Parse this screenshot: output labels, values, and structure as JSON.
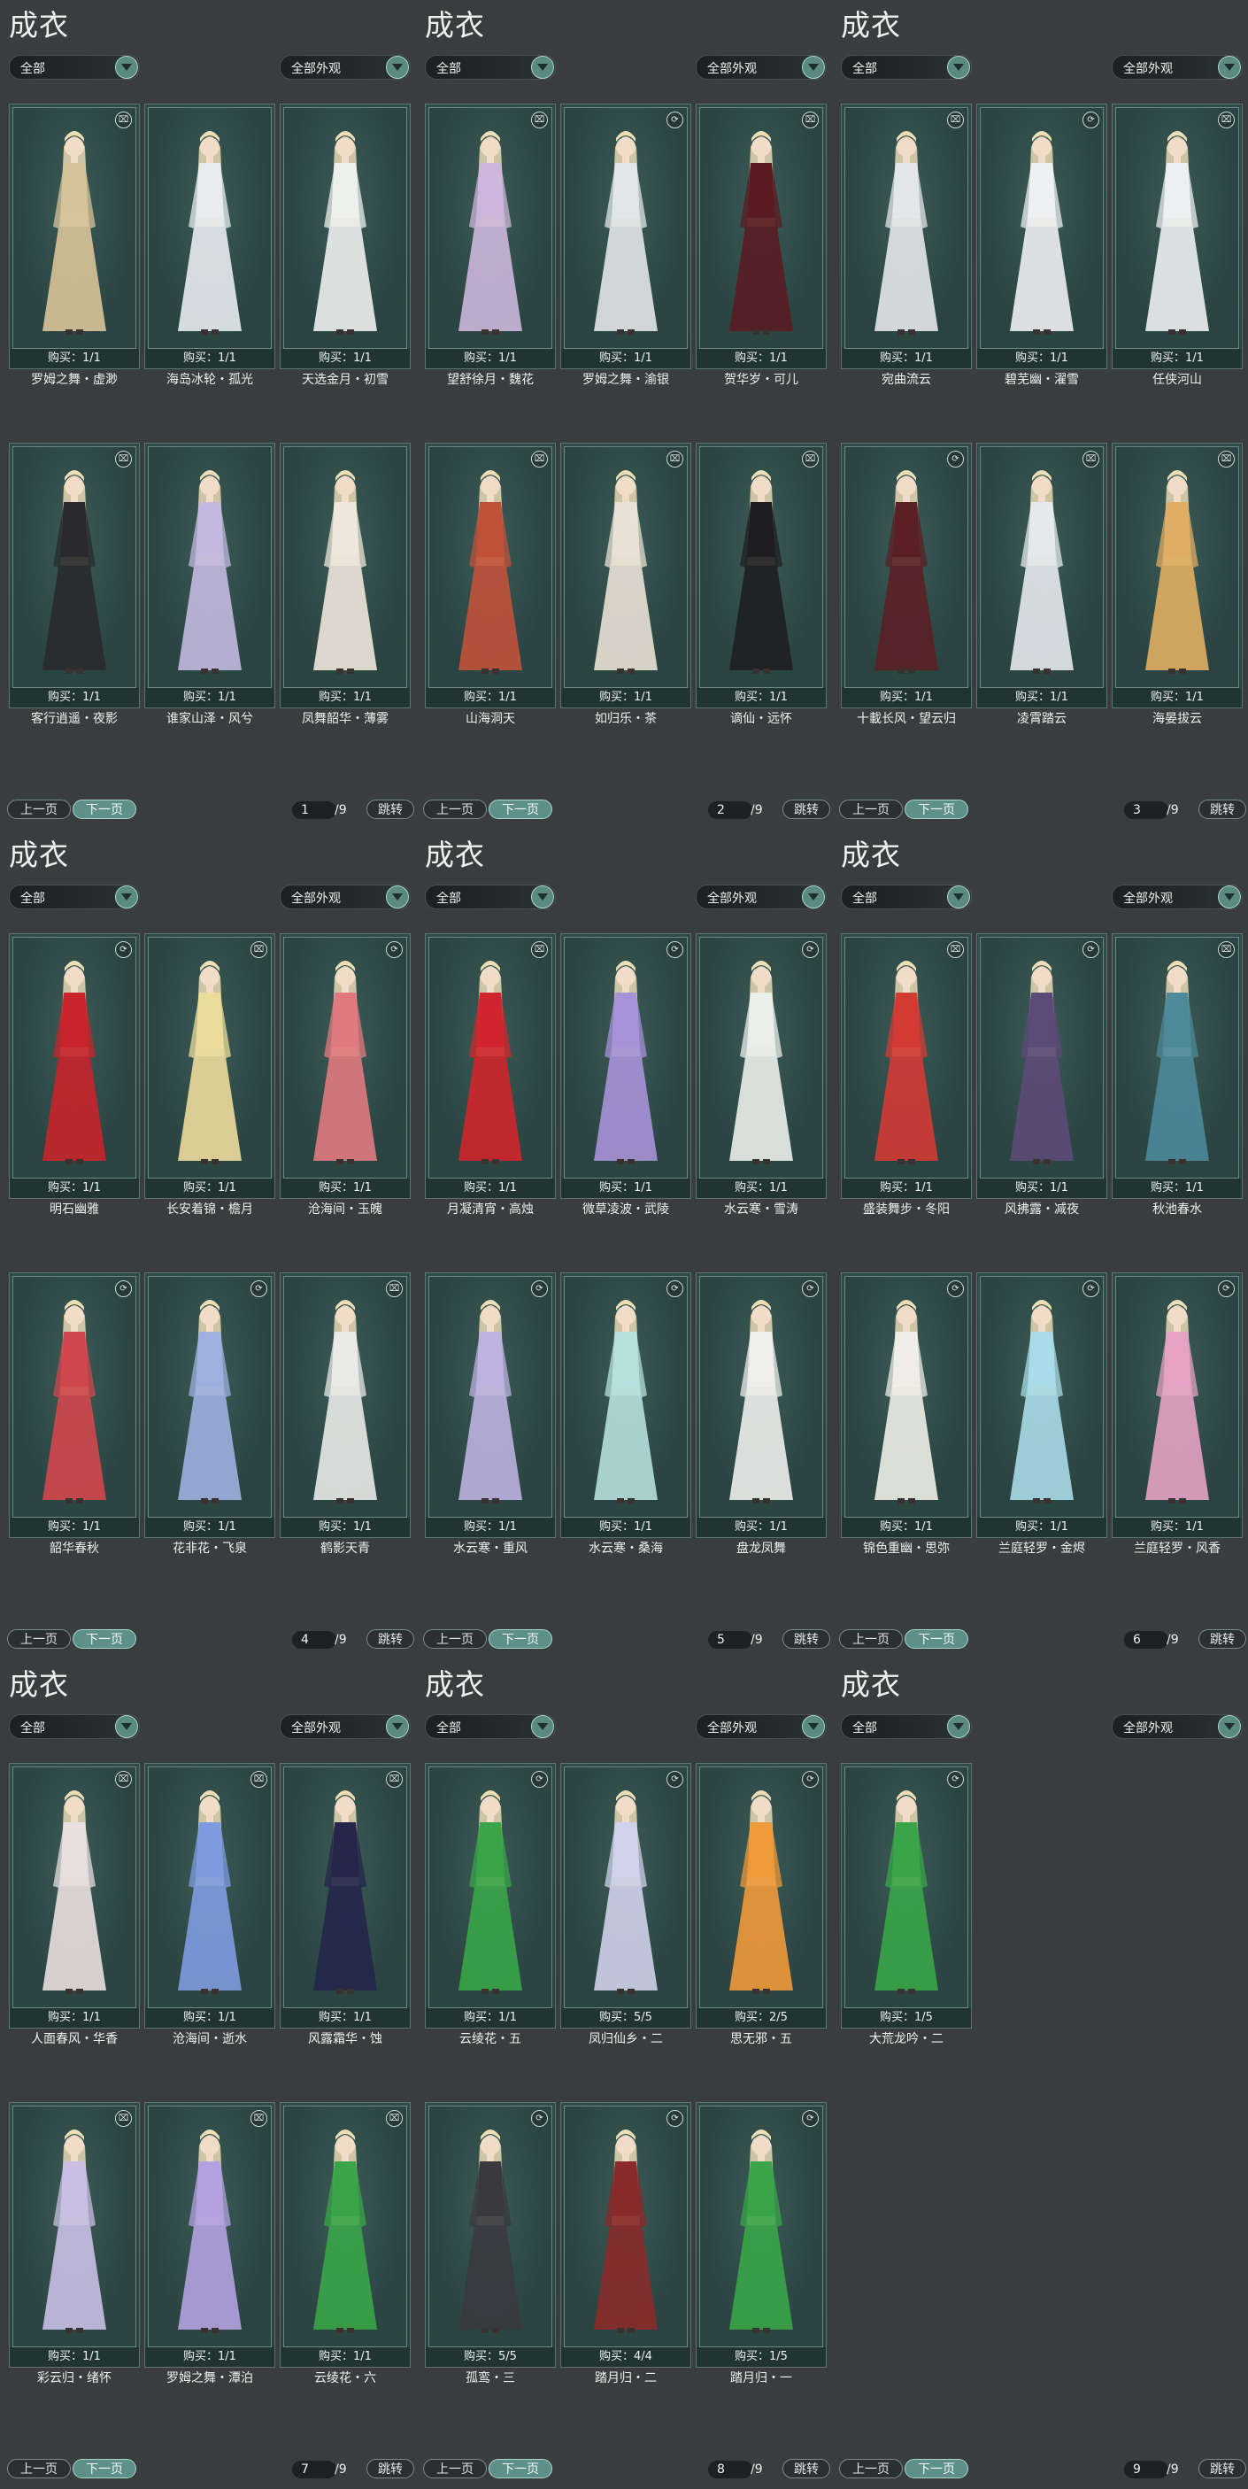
{
  "panels": [
    {
      "title": "成衣",
      "filter": "全部",
      "filter2": "全部外观",
      "page": "1",
      "total": "/9",
      "prev": "上一页",
      "next": "下一页",
      "jump": "跳转",
      "items": [
        {
          "name": "罗姆之舞・虚渺",
          "buy": "购买：1/1",
          "icon": "trash-icon",
          "robe": "#d8c49a"
        },
        {
          "name": "海岛冰轮・孤光",
          "buy": "购买：1/1",
          "icon": "",
          "robe": "#e8ecef"
        },
        {
          "name": "天选金月・初雪",
          "buy": "购买：1/1",
          "icon": "",
          "robe": "#eef0ee"
        },
        {
          "name": "客行逍遥・夜影",
          "buy": "购买：1/1",
          "icon": "trash-icon",
          "robe": "#2a2a2e"
        },
        {
          "name": "谁家山泽・风兮",
          "buy": "购买：1/1",
          "icon": "",
          "robe": "#c3b9e0"
        },
        {
          "name": "凤舞韶华・薄雾",
          "buy": "购买：1/1",
          "icon": "",
          "robe": "#efe7db"
        }
      ]
    },
    {
      "title": "成衣",
      "filter": "全部",
      "filter2": "全部外观",
      "page": "2",
      "total": "/9",
      "prev": "上一页",
      "next": "下一页",
      "jump": "跳转",
      "items": [
        {
          "name": "望舒徐月・魏花",
          "buy": "购买：1/1",
          "icon": "trash-icon",
          "robe": "#cdb6dc"
        },
        {
          "name": "罗姆之舞・渝银",
          "buy": "购买：1/1",
          "icon": "refresh-icon",
          "robe": "#e2e5e8"
        },
        {
          "name": "贺华岁・可儿",
          "buy": "购买：1/1",
          "icon": "trash-icon",
          "robe": "#5a1c22"
        },
        {
          "name": "山海洞天",
          "buy": "购买：1/1",
          "icon": "trash-icon",
          "robe": "#c0523a"
        },
        {
          "name": "如归乐・茶",
          "buy": "购买：1/1",
          "icon": "trash-icon",
          "robe": "#e9e1d5"
        },
        {
          "name": "谪仙・远怀",
          "buy": "购买：1/1",
          "icon": "trash-icon",
          "robe": "#1f1f22"
        }
      ]
    },
    {
      "title": "成衣",
      "filter": "全部",
      "filter2": "全部外观",
      "page": "3",
      "total": "/9",
      "prev": "上一页",
      "next": "下一页",
      "jump": "跳转",
      "items": [
        {
          "name": "宛曲流云",
          "buy": "购买：1/1",
          "icon": "trash-icon",
          "robe": "#e4e7ea"
        },
        {
          "name": "碧芜幽・濯雪",
          "buy": "购买：1/1",
          "icon": "refresh-icon",
          "robe": "#eef0f2"
        },
        {
          "name": "任侠河山",
          "buy": "购买：1/1",
          "icon": "trash-icon",
          "robe": "#edeff1"
        },
        {
          "name": "十載长风・望云归",
          "buy": "购买：1/1",
          "icon": "refresh-icon",
          "robe": "#5a2025"
        },
        {
          "name": "凌霄踏云",
          "buy": "购买：1/1",
          "icon": "trash-icon",
          "robe": "#e6e9ec"
        },
        {
          "name": "海晏拔云",
          "buy": "购买：1/1",
          "icon": "trash-icon",
          "robe": "#e0ae62"
        }
      ]
    },
    {
      "title": "成衣",
      "filter": "全部",
      "filter2": "全部外观",
      "page": "4",
      "total": "/9",
      "prev": "上一页",
      "next": "下一页",
      "jump": "跳转",
      "items": [
        {
          "name": "明石幽雅",
          "buy": "购买：1/1",
          "icon": "refresh-icon",
          "robe": "#c8242a"
        },
        {
          "name": "长安着锦・檐月",
          "buy": "购买：1/1",
          "icon": "trash-icon",
          "robe": "#ecdc9c"
        },
        {
          "name": "沧海间・玉魄",
          "buy": "购买：1/1",
          "icon": "refresh-icon",
          "robe": "#e07a80"
        },
        {
          "name": "韶华春秋",
          "buy": "购买：1/1",
          "icon": "refresh-icon",
          "robe": "#d2474d"
        },
        {
          "name": "花非花・飞泉",
          "buy": "购买：1/1",
          "icon": "refresh-icon",
          "robe": "#9fb0e0"
        },
        {
          "name": "鹤影天青",
          "buy": "购买：1/1",
          "icon": "trash-icon",
          "robe": "#e9eae8"
        }
      ]
    },
    {
      "title": "成衣",
      "filter": "全部",
      "filter2": "全部外观",
      "page": "5",
      "total": "/9",
      "prev": "上一页",
      "next": "下一页",
      "jump": "跳转",
      "items": [
        {
          "name": "月凝清宵・高烛",
          "buy": "购买：1/1",
          "icon": "trash-icon",
          "robe": "#d0252c"
        },
        {
          "name": "微草凌波・武陵",
          "buy": "购买：1/1",
          "icon": "refresh-icon",
          "robe": "#a792d8"
        },
        {
          "name": "水云寒・雪涛",
          "buy": "购买：1/1",
          "icon": "refresh-icon",
          "robe": "#ebeeea"
        },
        {
          "name": "水云寒・重风",
          "buy": "购买：1/1",
          "icon": "refresh-icon",
          "robe": "#bdb2e0"
        },
        {
          "name": "水云寒・桑海",
          "buy": "购买：1/1",
          "icon": "refresh-icon",
          "robe": "#b6e0de"
        },
        {
          "name": "盘龙凤舞",
          "buy": "购买：1/1",
          "icon": "refresh-icon",
          "robe": "#eeeeec"
        }
      ]
    },
    {
      "title": "成衣",
      "filter": "全部",
      "filter2": "全部外观",
      "page": "6",
      "total": "/9",
      "prev": "上一页",
      "next": "下一页",
      "jump": "跳转",
      "items": [
        {
          "name": "盛装舞步・冬阳",
          "buy": "购买：1/1",
          "icon": "trash-icon",
          "robe": "#d33a34"
        },
        {
          "name": "风拂露・减夜",
          "buy": "购买：1/1",
          "icon": "refresh-icon",
          "robe": "#5c4a78"
        },
        {
          "name": "秋池春水",
          "buy": "购买：1/1",
          "icon": "trash-icon",
          "robe": "#4d8a9a"
        },
        {
          "name": "锦色重幽・思弥",
          "buy": "购买：1/1",
          "icon": "refresh-icon",
          "robe": "#eeeee6"
        },
        {
          "name": "兰庭轻罗・金烬",
          "buy": "购买：1/1",
          "icon": "refresh-icon",
          "robe": "#a8dce8"
        },
        {
          "name": "兰庭轻罗・风香",
          "buy": "购买：1/1",
          "icon": "refresh-icon",
          "robe": "#e6a2c4"
        }
      ]
    },
    {
      "title": "成衣",
      "filter": "全部",
      "filter2": "全部外观",
      "page": "7",
      "total": "/9",
      "prev": "上一页",
      "next": "下一页",
      "jump": "跳转",
      "items": [
        {
          "name": "人面春风・华香",
          "buy": "购买：1/1",
          "icon": "trash-icon",
          "robe": "#eadfe0"
        },
        {
          "name": "沧海间・逝水",
          "buy": "购买：1/1",
          "icon": "trash-icon",
          "robe": "#7f9be0"
        },
        {
          "name": "风露霜华・蚀",
          "buy": "购买：1/1",
          "icon": "trash-icon",
          "robe": "#25264a"
        },
        {
          "name": "彩云归・绪怀",
          "buy": "购买：1/1",
          "icon": "trash-icon",
          "robe": "#c9bfe4"
        },
        {
          "name": "罗姆之舞・潭泊",
          "buy": "购买：1/1",
          "icon": "trash-icon",
          "robe": "#b4a1e0"
        },
        {
          "name": "云绫花・六",
          "buy": "购买：1/1",
          "icon": "trash-icon",
          "robe": "#3aa548"
        }
      ]
    },
    {
      "title": "成衣",
      "filter": "全部",
      "filter2": "全部外观",
      "page": "8",
      "total": "/9",
      "prev": "上一页",
      "next": "下一页",
      "jump": "跳转",
      "items": [
        {
          "name": "云绫花・五",
          "buy": "购买：1/1",
          "icon": "refresh-icon",
          "robe": "#3aa548"
        },
        {
          "name": "凤归仙乡・二",
          "buy": "购买：5/5",
          "icon": "refresh-icon",
          "robe": "#cfd2ea"
        },
        {
          "name": "思无邪・五",
          "buy": "购买：2/5",
          "icon": "refresh-icon",
          "robe": "#ef9a3a"
        },
        {
          "name": "孤鸾・三",
          "buy": "购买：5/5",
          "icon": "refresh-icon",
          "robe": "#3a3a3e"
        },
        {
          "name": "踏月归・二",
          "buy": "购买：4/4",
          "icon": "refresh-icon",
          "robe": "#8a2a2a"
        },
        {
          "name": "踏月归・一",
          "buy": "购买：1/5",
          "icon": "refresh-icon",
          "robe": "#3aa548"
        }
      ]
    },
    {
      "title": "成衣",
      "filter": "全部",
      "filter2": "全部外观",
      "page": "9",
      "total": "/9",
      "prev": "上一页",
      "next": "下一页",
      "jump": "跳转",
      "items": [
        {
          "name": "大荒龙吟・二",
          "buy": "购买：1/5",
          "icon": "refresh-icon",
          "robe": "#3aa548"
        }
      ]
    }
  ]
}
